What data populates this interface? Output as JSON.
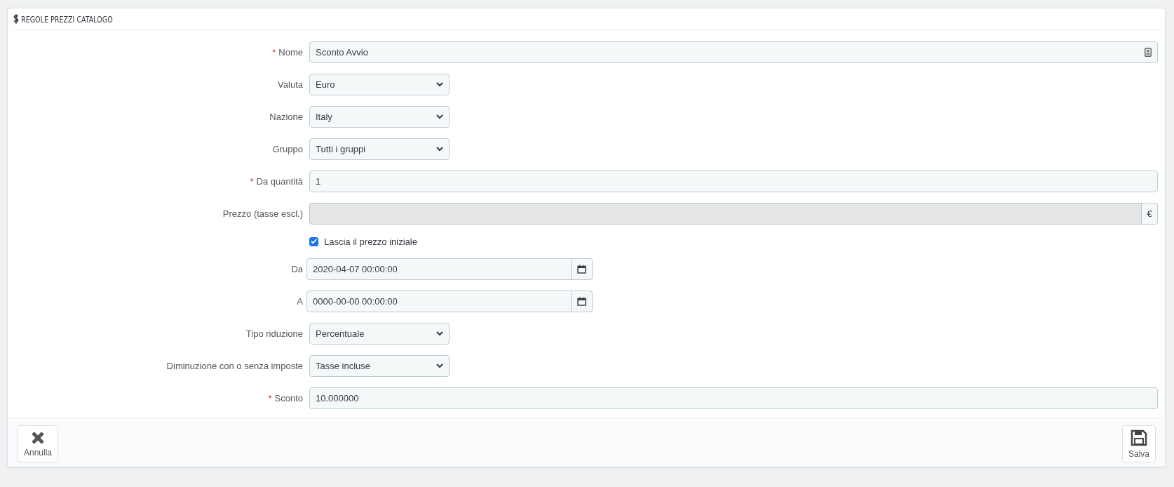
{
  "panel": {
    "title": "REGOLE PREZZI CATALOGO"
  },
  "fields": [
    {
      "kind": "text-icon",
      "label": "Nome",
      "required_mark": "*",
      "value": "Sconto Avvio"
    },
    {
      "kind": "select",
      "label": "Valuta",
      "value": "Euro"
    },
    {
      "kind": "select",
      "label": "Nazione",
      "value": "Italy"
    },
    {
      "kind": "select",
      "label": "Gruppo",
      "value": "Tutti i gruppi"
    },
    {
      "kind": "text",
      "label": "Da quantità",
      "required_mark": "*",
      "value": "1"
    },
    {
      "kind": "addon",
      "label": "Prezzo (tasse escl.)",
      "disabled": true,
      "addon": "€"
    },
    {
      "kind": "checkbox",
      "label": "Lascia il prezzo iniziale",
      "checked": true
    },
    {
      "kind": "date",
      "label": "Da",
      "value": "2020-04-07 00:00:00"
    },
    {
      "kind": "date",
      "label": "A",
      "value": "0000-00-00 00:00:00"
    },
    {
      "kind": "select",
      "label": "Tipo riduzione",
      "value": "Percentuale"
    },
    {
      "kind": "select",
      "label": "Diminuzione con o senza imposte",
      "value": "Tasse incluse"
    },
    {
      "kind": "text",
      "label": "Sconto",
      "required_mark": "*",
      "value": "10.000000"
    }
  ],
  "footer": {
    "buttons": [
      {
        "kind": "cancel",
        "label": "Annulla"
      },
      {
        "kind": "save",
        "label": "Salva"
      }
    ]
  }
}
